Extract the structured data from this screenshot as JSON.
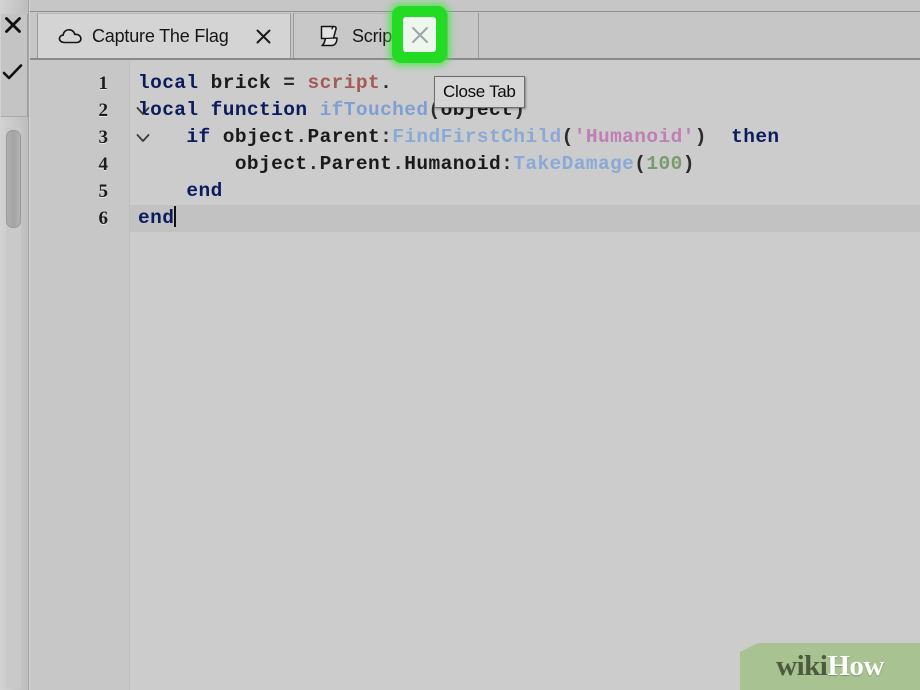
{
  "window": {
    "background_color": "#cccccc",
    "chrome_color": "#c6c6c6"
  },
  "left_toolbar": {
    "name": "left-tool-strip",
    "items": [
      {
        "icon": "close-icon",
        "tooltip": "Close"
      },
      {
        "icon": "checkmark-icon",
        "tooltip": "Accept"
      }
    ],
    "scrollbar": {
      "name": "vertical-scrollbar",
      "thumb_position_percent": 18
    }
  },
  "tabbar": {
    "tabs": [
      {
        "label": "Capture The Flag",
        "icon": "cloud-icon",
        "close_icon": "close-icon",
        "active": true
      },
      {
        "label": "Scrip",
        "icon": "script-document-icon",
        "close_icon": "close-icon",
        "active": false
      }
    ]
  },
  "highlight": {
    "name": "green-highlight-box",
    "color": "#24db24",
    "target": "close-tab-button"
  },
  "tooltip": {
    "text": "Close Tab"
  },
  "editor": {
    "language": "lua",
    "current_line": 6,
    "caret_line": 6,
    "lines": [
      {
        "number": "1",
        "fold": false,
        "tokens": [
          {
            "text": "local",
            "type": "kw"
          },
          {
            "text": " ",
            "type": "plain"
          },
          {
            "text": "brick",
            "type": "plain"
          },
          {
            "text": " ",
            "type": "plain"
          },
          {
            "text": "=",
            "type": "punct"
          },
          {
            "text": " ",
            "type": "plain"
          },
          {
            "text": "script",
            "type": "script"
          },
          {
            "text": ".",
            "type": "punct"
          }
        ]
      },
      {
        "number": "2",
        "fold": true,
        "tokens": [
          {
            "text": "local",
            "type": "kw"
          },
          {
            "text": " ",
            "type": "plain"
          },
          {
            "text": "function",
            "type": "kw"
          },
          {
            "text": " ",
            "type": "plain"
          },
          {
            "text": "ifTouched",
            "type": "fn"
          },
          {
            "text": "(",
            "type": "punct"
          },
          {
            "text": "object",
            "type": "plain"
          },
          {
            "text": ")",
            "type": "punct"
          }
        ]
      },
      {
        "number": "3",
        "fold": true,
        "tokens": [
          {
            "text": "    ",
            "type": "plain"
          },
          {
            "text": "if",
            "type": "kw"
          },
          {
            "text": " ",
            "type": "plain"
          },
          {
            "text": "object",
            "type": "plain"
          },
          {
            "text": ".",
            "type": "punct"
          },
          {
            "text": "Parent",
            "type": "plain"
          },
          {
            "text": ":",
            "type": "punct"
          },
          {
            "text": "FindFirstChild",
            "type": "method"
          },
          {
            "text": "(",
            "type": "punct"
          },
          {
            "text": "'Humanoid'",
            "type": "str"
          },
          {
            "text": ")",
            "type": "punct"
          },
          {
            "text": "  ",
            "type": "plain"
          },
          {
            "text": "then",
            "type": "kw"
          }
        ]
      },
      {
        "number": "4",
        "fold": false,
        "tokens": [
          {
            "text": "        ",
            "type": "plain"
          },
          {
            "text": "object",
            "type": "plain"
          },
          {
            "text": ".",
            "type": "punct"
          },
          {
            "text": "Parent",
            "type": "plain"
          },
          {
            "text": ".",
            "type": "punct"
          },
          {
            "text": "Humanoid",
            "type": "plain"
          },
          {
            "text": ":",
            "type": "punct"
          },
          {
            "text": "TakeDamage",
            "type": "method"
          },
          {
            "text": "(",
            "type": "punct"
          },
          {
            "text": "100",
            "type": "num"
          },
          {
            "text": ")",
            "type": "punct"
          }
        ]
      },
      {
        "number": "5",
        "fold": false,
        "tokens": [
          {
            "text": "    ",
            "type": "plain"
          },
          {
            "text": "end",
            "type": "kw"
          }
        ]
      },
      {
        "number": "6",
        "fold": false,
        "caret": true,
        "tokens": [
          {
            "text": "end",
            "type": "kw"
          }
        ]
      }
    ]
  },
  "watermark": {
    "part1": "wiki",
    "part2": "How",
    "banner_color": "#a8c391"
  }
}
